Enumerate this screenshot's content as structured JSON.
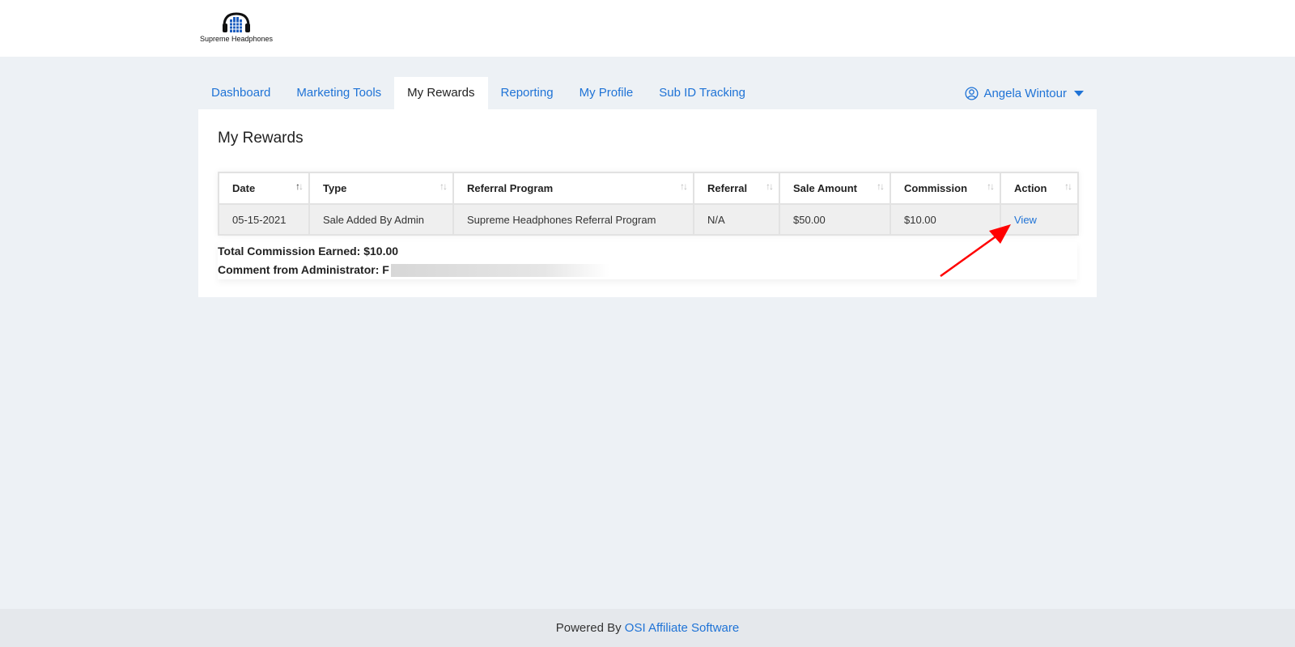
{
  "brand": {
    "name": "Supreme Headphones",
    "logo_icon": "headphones-logo-icon"
  },
  "nav": {
    "tabs": [
      {
        "label": "Dashboard"
      },
      {
        "label": "Marketing Tools"
      },
      {
        "label": "My Rewards",
        "active": true
      },
      {
        "label": "Reporting"
      },
      {
        "label": "My Profile"
      },
      {
        "label": "Sub ID Tracking"
      }
    ],
    "user": {
      "name": "Angela Wintour",
      "icon": "user-circle-icon"
    }
  },
  "page": {
    "title": "My Rewards"
  },
  "table": {
    "columns": [
      "Date",
      "Type",
      "Referral Program",
      "Referral",
      "Sale Amount",
      "Commission",
      "Action"
    ],
    "rows": [
      {
        "date": "05-15-2021",
        "type": "Sale Added By Admin",
        "referral_program": "Supreme Headphones Referral Program",
        "referral": "N/A",
        "sale_amount": "$50.00",
        "commission": "$10.00",
        "action": "View"
      }
    ]
  },
  "summary": {
    "total_label": "Total Commission Earned: $10.00",
    "comment_label": "Comment from Administrator: F"
  },
  "footer": {
    "prefix": "Powered By",
    "link": "OSI Affiliate Software"
  },
  "colors": {
    "accent": "#1f73d6",
    "background": "#edf1f5",
    "annotation_arrow": "#ff0000"
  }
}
